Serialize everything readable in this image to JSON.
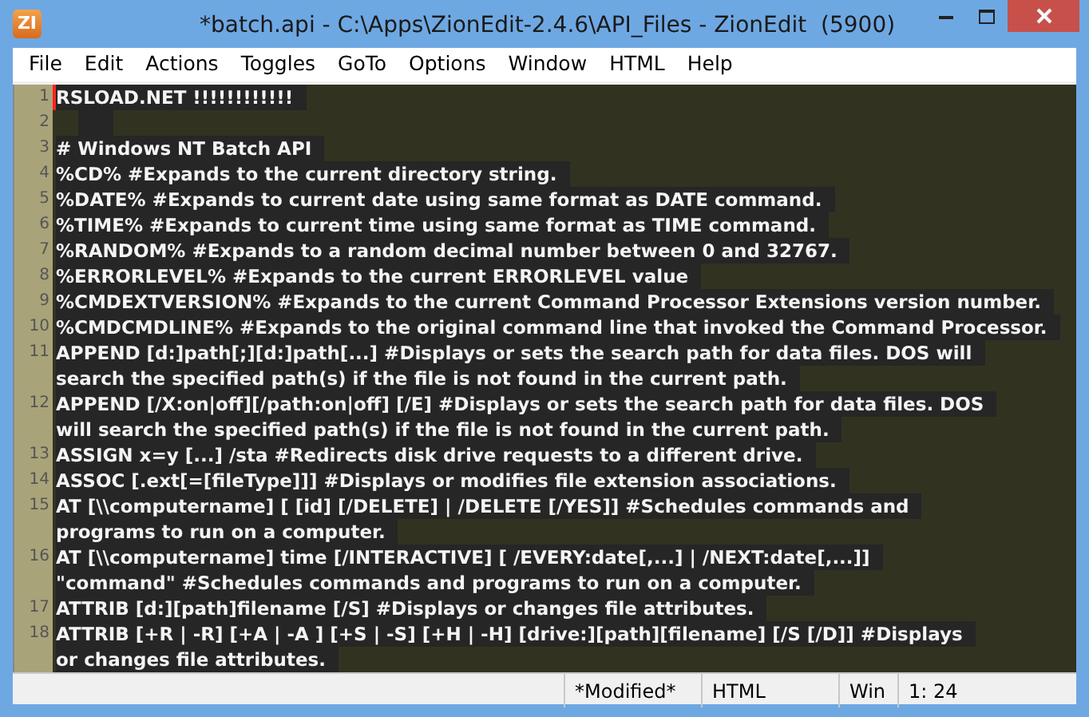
{
  "window": {
    "title": "*batch.api - C:\\Apps\\ZionEdit-2.4.6\\API_Files - ZionEdit  (5900)",
    "icon_text": "ZI"
  },
  "menu": [
    "File",
    "Edit",
    "Actions",
    "Toggles",
    "GoTo",
    "Options",
    "Window",
    "HTML",
    "Help"
  ],
  "editor": {
    "lines": [
      {
        "number": "1",
        "cursor": true,
        "text": [
          "RSLOAD.NET !!!!!!!!!!!!"
        ]
      },
      {
        "number": "2",
        "cursor": false
      },
      {
        "number": "3",
        "cursor": false,
        "text": [
          "# Windows NT Batch API"
        ]
      },
      {
        "number": "4",
        "cursor": false,
        "text": [
          "%CD% #Expands to the current directory string."
        ]
      },
      {
        "number": "5",
        "cursor": false,
        "text": [
          "%DATE% #Expands to current date using same format as DATE command."
        ]
      },
      {
        "number": "6",
        "cursor": false,
        "text": [
          "%TIME% #Expands to current time using same format as TIME command."
        ]
      },
      {
        "number": "7",
        "cursor": false,
        "text": [
          "%RANDOM% #Expands to a random decimal number between 0 and 32767."
        ]
      },
      {
        "number": "8",
        "cursor": false,
        "text": [
          "%ERRORLEVEL% #Expands to the current ERRORLEVEL value"
        ]
      },
      {
        "number": "9",
        "cursor": false,
        "text": [
          "%CMDEXTVERSION% #Expands to the current Command Processor Extensions version number."
        ]
      },
      {
        "number": "10",
        "cursor": false,
        "text": [
          "%CMDCMDLINE% #Expands to the original command line that invoked the Command Processor."
        ]
      },
      {
        "number": "11",
        "cursor": false,
        "text": [
          "APPEND [d:]path[;][d:]path[...] #Displays or sets the search path for data files. DOS will",
          "search the specified path(s) if the file is not found in the current path."
        ]
      },
      {
        "number": "12",
        "cursor": false,
        "text": [
          "APPEND [/X:on|off][/path:on|off] [/E] #Displays or sets the search path for data files. DOS",
          "will search the specified path(s) if the file is not found in the current path."
        ]
      },
      {
        "number": "13",
        "cursor": false,
        "text": [
          "ASSIGN x=y [...] /sta #Redirects disk drive requests to a different drive."
        ]
      },
      {
        "number": "14",
        "cursor": false,
        "text": [
          "ASSOC [.ext[=[fileType]]] #Displays or modifies file extension associations."
        ]
      },
      {
        "number": "15",
        "cursor": false,
        "text": [
          "AT [\\\\computername] [ [id] [/DELETE] | /DELETE [/YES]] #Schedules commands and",
          "programs to run on a computer."
        ]
      },
      {
        "number": "16",
        "cursor": false,
        "text": [
          "AT [\\\\computername] time [/INTERACTIVE] [ /EVERY:date[,...] | /NEXT:date[,...]]",
          "\"command\" #Schedules commands and programs to run on a computer."
        ]
      },
      {
        "number": "17",
        "cursor": false,
        "text": [
          "ATTRIB [d:][path]filename [/S] #Displays or changes file attributes."
        ]
      },
      {
        "number": "18",
        "cursor": false,
        "text": [
          "ATTRIB [+R | -R] [+A | -A ] [+S | -S] [+H | -H] [drive:][path][filename] [/S [/D]] #Displays",
          "or changes file attributes."
        ]
      }
    ]
  },
  "status_bar": [
    "*Modified*",
    "HTML",
    "Win",
    "1: 24"
  ]
}
